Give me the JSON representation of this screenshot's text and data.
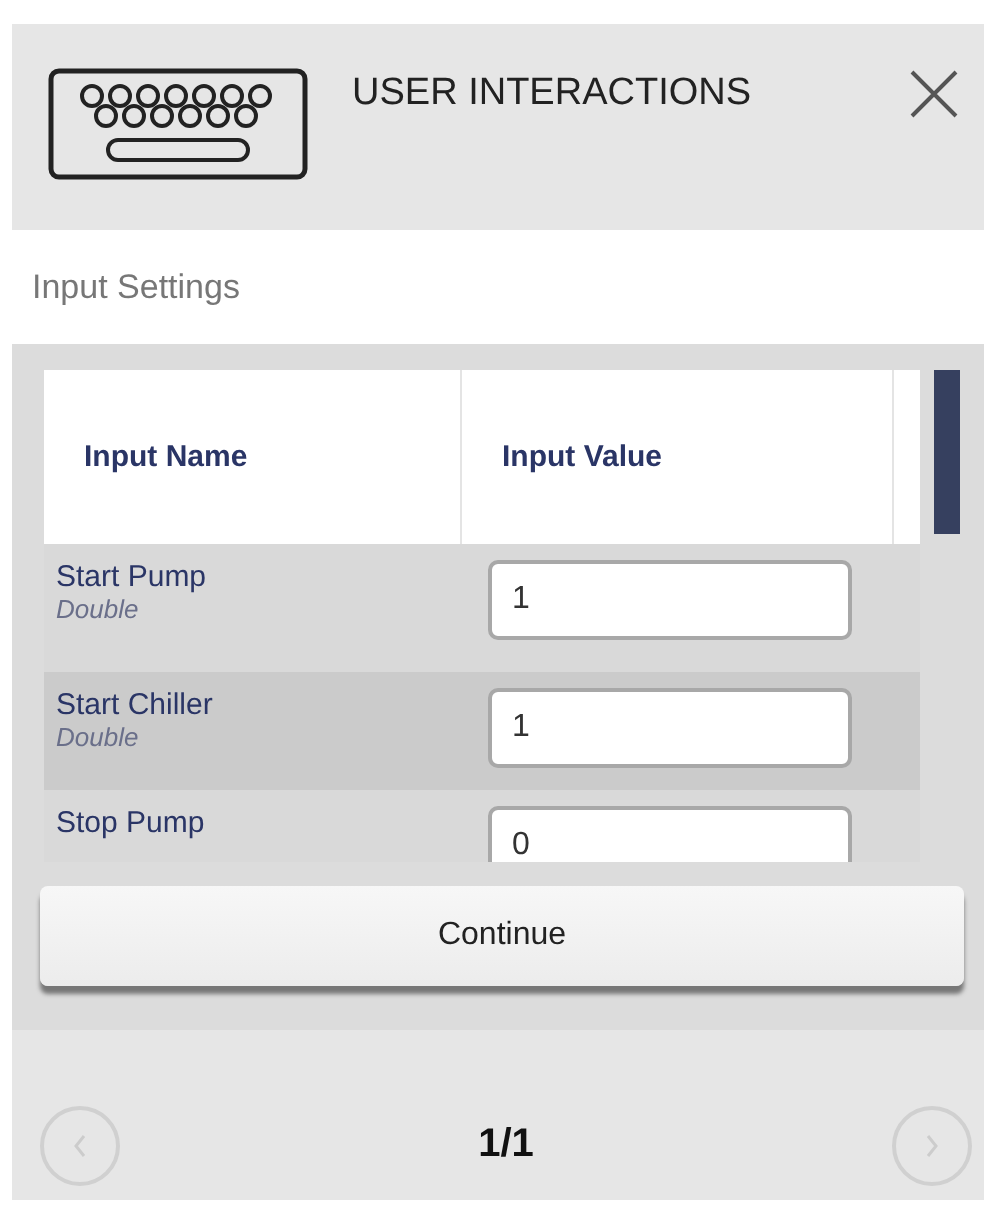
{
  "dialog": {
    "title": "USER INTERACTIONS"
  },
  "section": {
    "title": "Input Settings"
  },
  "table": {
    "columns": [
      "Input Name",
      "Input Value"
    ],
    "rows": [
      {
        "name": "Start Pump",
        "type": "Double",
        "value": "1",
        "selected": false
      },
      {
        "name": "Start Chiller",
        "type": "Double",
        "value": "1",
        "selected": true
      },
      {
        "name": "Stop Pump",
        "value": "0",
        "selected": false
      }
    ]
  },
  "continue_button": "Continue",
  "pager": {
    "label": "1/1",
    "prev_disabled": true,
    "next_disabled": true
  }
}
